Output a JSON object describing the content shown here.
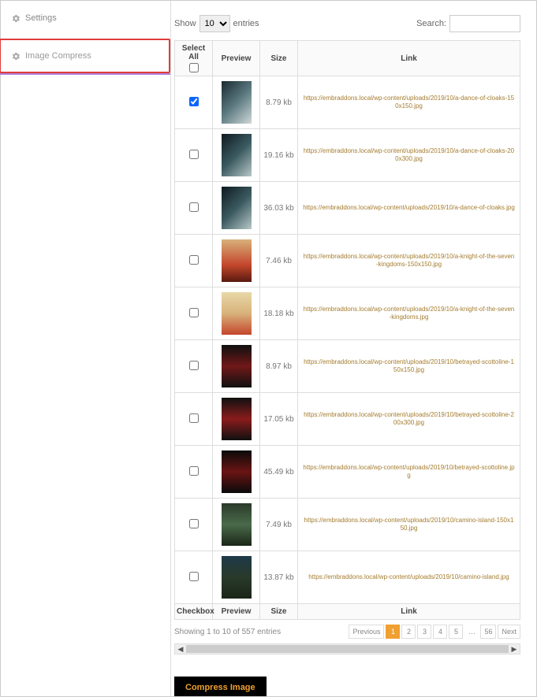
{
  "sidebar": {
    "items": [
      {
        "label": "Settings",
        "active": false
      },
      {
        "label": "Image Compress",
        "active": true
      }
    ]
  },
  "toolbar": {
    "show_label": "Show",
    "entries_label": "entries",
    "entries_value": "10",
    "search_label": "Search:"
  },
  "headers": {
    "select_all": "Select All",
    "preview": "Preview",
    "size": "Size",
    "link": "Link",
    "checkbox_footer": "Checkbox"
  },
  "rows": [
    {
      "checked": true,
      "size": "8.79 kb",
      "link": "https://embraddons.local/wp-content/uploads/2019/10/a-dance-of-cloaks-150x150.jpg",
      "bg": "linear-gradient(135deg,#1a2a30,#5b7a80,#cfd8d8)"
    },
    {
      "checked": false,
      "size": "19.16 kb",
      "link": "https://embraddons.local/wp-content/uploads/2019/10/a-dance-of-cloaks-200x300.jpg",
      "bg": "linear-gradient(135deg,#0e1a20,#3a5a60,#b8c8c8)"
    },
    {
      "checked": false,
      "size": "36.03 kb",
      "link": "https://embraddons.local/wp-content/uploads/2019/10/a-dance-of-cloaks.jpg",
      "bg": "linear-gradient(135deg,#0e1a20,#3a5a60,#b8c8c8)"
    },
    {
      "checked": false,
      "size": "7.46 kb",
      "link": "https://embraddons.local/wp-content/uploads/2019/10/a-knight-of-the-seven-kingdoms-150x150.jpg",
      "bg": "linear-gradient(180deg,#d8b27a 0%,#c4462c 60%,#5a1a10 100%)"
    },
    {
      "checked": false,
      "size": "18.18 kb",
      "link": "https://embraddons.local/wp-content/uploads/2019/10/a-knight-of-the-seven-kingdoms.jpg",
      "bg": "linear-gradient(180deg,#e8d8a8 0%,#d8b27a 50%,#c4462c 100%)"
    },
    {
      "checked": false,
      "size": "8.97 kb",
      "link": "https://embraddons.local/wp-content/uploads/2019/10/betrayed-scottoline-150x150.jpg",
      "bg": "linear-gradient(180deg,#101010,#701818,#101010)"
    },
    {
      "checked": false,
      "size": "17.05 kb",
      "link": "https://embraddons.local/wp-content/uploads/2019/10/betrayed-scottoline-200x300.jpg",
      "bg": "linear-gradient(180deg,#101010,#8a1c1c,#101010)"
    },
    {
      "checked": false,
      "size": "45.49 kb",
      "link": "https://embraddons.local/wp-content/uploads/2019/10/betrayed-scottoline.jpg",
      "bg": "linear-gradient(180deg,#0a0a0a,#6a1414,#0a0a0a)"
    },
    {
      "checked": false,
      "size": "7.49 kb",
      "link": "https://embraddons.local/wp-content/uploads/2019/10/camino-island-150x150.jpg",
      "bg": "linear-gradient(180deg,#2a3a2a,#4a6a4a,#1a2618)"
    },
    {
      "checked": false,
      "size": "13.87 kb",
      "link": "https://embraddons.local/wp-content/uploads/2019/10/camino-island.jpg",
      "bg": "linear-gradient(180deg,#1e3a4a,#2a3a2a,#1a2618)"
    }
  ],
  "footer": {
    "info": "Showing 1 to 10 of 557 entries",
    "pager": {
      "prev": "Previous",
      "next": "Next",
      "pages": [
        "1",
        "2",
        "3",
        "4",
        "5"
      ],
      "last": "56",
      "active": "1"
    }
  },
  "actions": {
    "compress": "Compress Image"
  }
}
